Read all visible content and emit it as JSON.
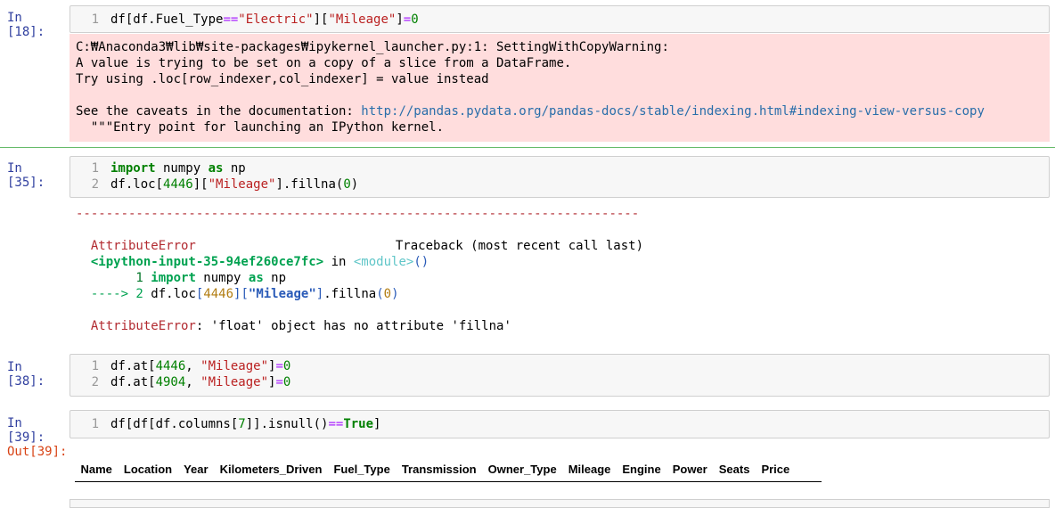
{
  "cell18": {
    "prompt": "In [18]:",
    "lines": [
      {
        "num": "1",
        "tokens": [
          {
            "t": "df[df.Fuel_Type",
            "c": ""
          },
          {
            "t": "==",
            "c": "op"
          },
          {
            "t": "\"Electric\"",
            "c": "str"
          },
          {
            "t": "][",
            "c": ""
          },
          {
            "t": "\"Mileage\"",
            "c": "str"
          },
          {
            "t": "]",
            "c": ""
          },
          {
            "t": "=",
            "c": "op"
          },
          {
            "t": "0",
            "c": "num"
          }
        ]
      }
    ],
    "stderr": [
      "C:₩Anaconda3₩lib₩site-packages₩ipykernel_launcher.py:1: SettingWithCopyWarning:",
      "A value is trying to be set on a copy of a slice from a DataFrame.",
      "Try using .loc[row_indexer,col_indexer] = value instead",
      "",
      "",
      "  \"\"\"Entry point for launching an IPython kernel."
    ],
    "caveats_prefix": "See the caveats in the documentation: ",
    "caveats_link": "http://pandas.pydata.org/pandas-docs/stable/indexing.html#indexing-view-versus-copy"
  },
  "cell35": {
    "prompt": "In [35]:",
    "lines": [
      {
        "num": "1",
        "tokens": [
          {
            "t": "import",
            "c": "kw"
          },
          {
            "t": " numpy ",
            "c": ""
          },
          {
            "t": "as",
            "c": "kw"
          },
          {
            "t": " np",
            "c": ""
          }
        ]
      },
      {
        "num": "2",
        "tokens": [
          {
            "t": "df.loc[",
            "c": ""
          },
          {
            "t": "4446",
            "c": "num"
          },
          {
            "t": "][",
            "c": ""
          },
          {
            "t": "\"Mileage\"",
            "c": "str"
          },
          {
            "t": "].fillna(",
            "c": ""
          },
          {
            "t": "0",
            "c": "num"
          },
          {
            "t": ")",
            "c": ""
          }
        ]
      }
    ],
    "traceback": {
      "dashes": "---------------------------------------------------------------------------",
      "error_name": "AttributeError",
      "traceback_label": "Traceback (most recent call last)",
      "input_ref": "<ipython-input-35-94ef260ce7fc>",
      "in_word": " in ",
      "module": "<module>",
      "module_parens": "()",
      "line1_num": "      1 ",
      "line1_kw": "import",
      "line1_rest": " numpy ",
      "line1_as": "as",
      "line1_np": " np",
      "arrow": "----> 2 ",
      "line2_a": "df.loc",
      "line2_b": "[",
      "line2_c": "4446",
      "line2_d": "][",
      "line2_e": "\"Mileage\"",
      "line2_f": "]",
      "line2_g": ".fillna",
      "line2_h": "(",
      "line2_i": "0",
      "line2_j": ")",
      "final_error": "AttributeError",
      "final_msg": ": 'float' object has no attribute 'fillna'"
    }
  },
  "cell38": {
    "prompt": "In [38]:",
    "lines": [
      {
        "num": "1",
        "tokens": [
          {
            "t": "df.at[",
            "c": ""
          },
          {
            "t": "4446",
            "c": "num"
          },
          {
            "t": ", ",
            "c": ""
          },
          {
            "t": "\"Mileage\"",
            "c": "str"
          },
          {
            "t": "]",
            "c": ""
          },
          {
            "t": "=",
            "c": "op"
          },
          {
            "t": "0",
            "c": "num"
          }
        ]
      },
      {
        "num": "2",
        "tokens": [
          {
            "t": "df.at[",
            "c": ""
          },
          {
            "t": "4904",
            "c": "num"
          },
          {
            "t": ", ",
            "c": ""
          },
          {
            "t": "\"Mileage\"",
            "c": "str"
          },
          {
            "t": "]",
            "c": ""
          },
          {
            "t": "=",
            "c": "op"
          },
          {
            "t": "0",
            "c": "num"
          }
        ]
      }
    ]
  },
  "cell39": {
    "prompt": "In [39]:",
    "out_prompt": "Out[39]:",
    "lines": [
      {
        "num": "1",
        "tokens": [
          {
            "t": "df[df[df.columns[",
            "c": ""
          },
          {
            "t": "7",
            "c": "num"
          },
          {
            "t": "]].isnull()",
            "c": ""
          },
          {
            "t": "==",
            "c": "op"
          },
          {
            "t": "True",
            "c": "kw"
          },
          {
            "t": "]",
            "c": ""
          }
        ]
      }
    ],
    "table_columns": [
      "Name",
      "Location",
      "Year",
      "Kilometers_Driven",
      "Fuel_Type",
      "Transmission",
      "Owner_Type",
      "Mileage",
      "Engine",
      "Power",
      "Seats",
      "Price"
    ]
  }
}
